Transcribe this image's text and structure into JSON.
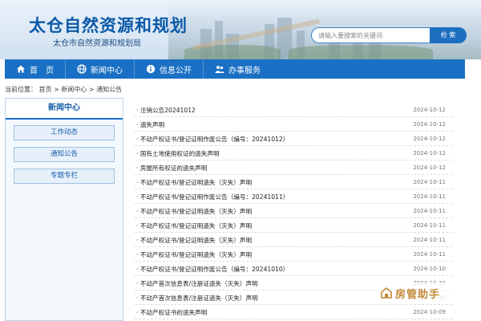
{
  "header": {
    "title": "太仓自然资源和规划",
    "subtitle": "太仓市自然资源和规划局",
    "search_placeholder": "请输入要搜索的关键词",
    "search_button": "检 索"
  },
  "nav": {
    "items": [
      {
        "label": "首　页",
        "icon": "home-icon"
      },
      {
        "label": "新闻中心",
        "icon": "globe-icon"
      },
      {
        "label": "信息公开",
        "icon": "info-icon"
      },
      {
        "label": "办事服务",
        "icon": "people-icon"
      }
    ]
  },
  "breadcrumb": "当前位置： 首页 > 新闻中心 > 通知公告",
  "sidebar": {
    "title": "新闻中心",
    "items": [
      "工作动态",
      "通知公告",
      "专题专栏"
    ]
  },
  "notices": [
    {
      "title": "· 注销公告20241012",
      "date": "2024-10-12"
    },
    {
      "title": "· 遗失声明",
      "date": "2024-10-12"
    },
    {
      "title": "· 不动产权证书/登记证明作废公告（编号：20241012）",
      "date": "2024-10-12"
    },
    {
      "title": "· 国有土地使用权证的遗失声明",
      "date": "2024-10-12"
    },
    {
      "title": "· 房屋所有权证的遗失声明",
      "date": "2024-10-12"
    },
    {
      "title": "· 不动产权证书/登记证明遗失（灭失）声明",
      "date": "2024-10-11"
    },
    {
      "title": "· 不动产权证书/登记证明作废公告（编号：20241011）",
      "date": "2024-10-11"
    },
    {
      "title": "· 不动产权证书/登记证明遗失（灭失）声明",
      "date": "2024-10-11"
    },
    {
      "title": "· 不动产权证书/登记证明遗失（灭失）声明",
      "date": "2024-10-11"
    },
    {
      "title": "· 不动产权证书/登记证明遗失（灭失）声明",
      "date": "2024-10-11"
    },
    {
      "title": "· 不动产权证书/登记证明遗失（灭失）声明",
      "date": "2024-10-11"
    },
    {
      "title": "· 不动产权证书/登记证明作废公告（编号：20241010）",
      "date": "2024-10-10"
    },
    {
      "title": "· 不动产首次信息表/注册证遗失（灭失）声明",
      "date": "2024-10-10"
    },
    {
      "title": "· 不动产首次信息表/注册证遗失（灭失）声明",
      "date": "2024-10-10"
    },
    {
      "title": "· 不动产权证书的遗失声明",
      "date": "2024-10-09"
    }
  ],
  "watermark": "房管助手",
  "colors": {
    "accent": "#1a70c4",
    "title": "#0b5aa8"
  }
}
